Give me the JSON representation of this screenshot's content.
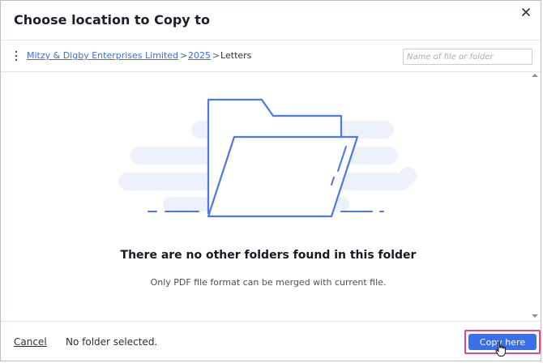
{
  "dialog": {
    "title": "Choose location to Copy to",
    "close_icon": "close-icon"
  },
  "nav": {
    "menu_icon": "kebab-icon",
    "breadcrumb": [
      {
        "label": "Mitzy & Digby Enterprises Limited",
        "link": true
      },
      {
        "label": "2025",
        "link": true
      },
      {
        "label": "Letters",
        "link": false
      }
    ],
    "separator": ">",
    "search_placeholder": "Name of file or folder",
    "search_value": ""
  },
  "content": {
    "illustration_icon": "empty-folder-icon",
    "empty_title": "There are no other folders found in this folder",
    "empty_subtitle": "Only PDF file format can be merged with current file."
  },
  "footer": {
    "cancel_label": "Cancel",
    "status": "No folder selected.",
    "copy_label": "Copy here"
  },
  "colors": {
    "accent": "#3b6fe8",
    "highlight": "#e0478f",
    "link": "#3b6fd8"
  }
}
